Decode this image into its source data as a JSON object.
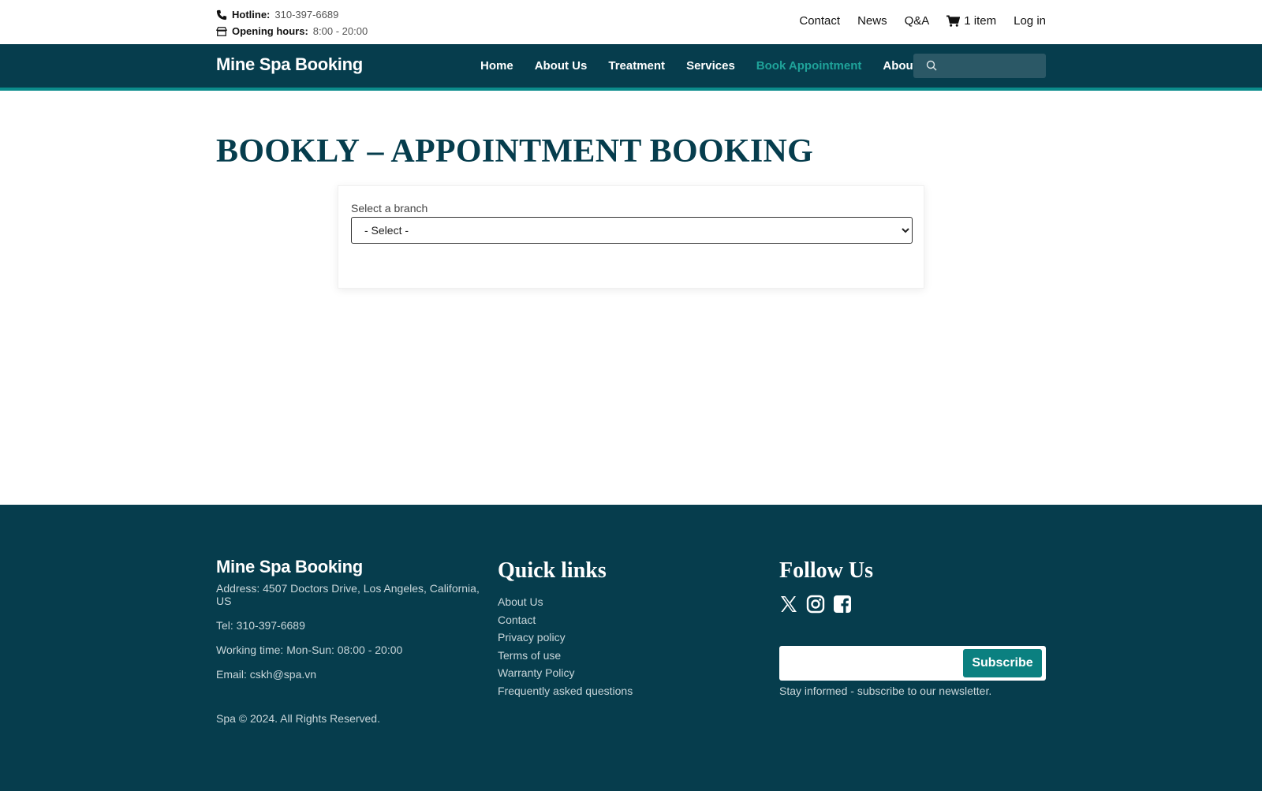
{
  "topbar": {
    "hotline_label": "Hotline:",
    "hotline_value": "310-397-6689",
    "hours_label": "Opening hours:",
    "hours_value": "8:00 - 20:00",
    "links": {
      "contact": "Contact",
      "news": "News",
      "qa": "Q&A",
      "cart": "1 item",
      "login": "Log in"
    }
  },
  "nav": {
    "brand": "Mine Spa Booking",
    "items": {
      "home": "Home",
      "about_us": "About Us",
      "treatment": "Treatment",
      "services": "Services",
      "book": "Book Appointment",
      "about": "About"
    },
    "search_placeholder": ""
  },
  "main": {
    "title": "BOOKLY – APPOINTMENT BOOKING",
    "branch_label": "Select a branch",
    "branch_selected": "- Select -"
  },
  "footer": {
    "brand": "Mine Spa Booking",
    "address": "Address: 4507 Doctors Drive, Los Angeles, California, US",
    "tel": "Tel: 310-397-6689",
    "working": "Working time: Mon-Sun: 08:00 - 20:00",
    "email": "Email: cskh@spa.vn",
    "copyright": "Spa © 2024. All Rights Reserved.",
    "quick_title": "Quick links",
    "quick_links": [
      "About Us",
      "Contact",
      "Privacy policy",
      "Terms of use",
      "Warranty Policy",
      "Frequently asked questions"
    ],
    "follow_title": "Follow Us",
    "subscribe_label": "Subscribe",
    "subscribe_note": "Stay informed - subscribe to our newsletter."
  },
  "colors": {
    "primary": "#063d4d",
    "accent": "#0b8080",
    "active": "#1fa39a"
  },
  "icons": [
    "phone-icon",
    "store-icon",
    "cart-icon",
    "chevron-down-icon",
    "search-icon",
    "x-twitter-icon",
    "instagram-icon",
    "facebook-icon"
  ]
}
